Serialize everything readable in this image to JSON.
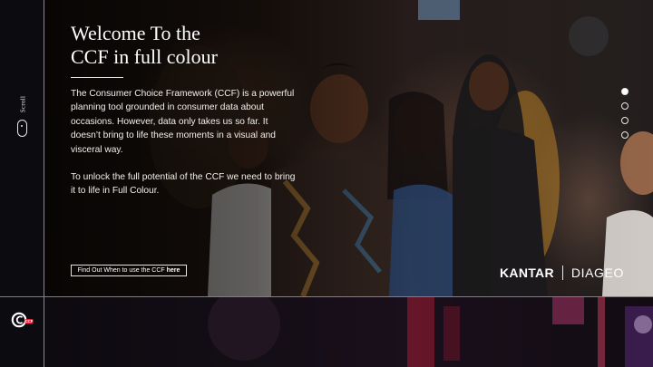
{
  "sidebar": {
    "scroll_label": "Scroll",
    "logo_text": "CCF"
  },
  "hero": {
    "title_line1": "Welcome To the",
    "title_line2": "CCF in full colour",
    "paragraph1": "The Consumer Choice Framework (CCF) is a powerful planning tool grounded in consumer data about occasions. However, data only takes us so far. It doesn’t bring to life these moments in a visual and visceral way.",
    "paragraph2": "To unlock the full potential of the CCF we need to bring it to life in Full Colour.",
    "cta_prefix": "Find Out When to use the CCF ",
    "cta_link": "here"
  },
  "brands": {
    "left": "KANTAR",
    "right": "DIAGEO"
  },
  "pagination": {
    "total": 4,
    "active_index": 0
  },
  "colors": {
    "background": "#0b0810",
    "accent_logo": "#e0233a",
    "text": "#ffffff"
  }
}
